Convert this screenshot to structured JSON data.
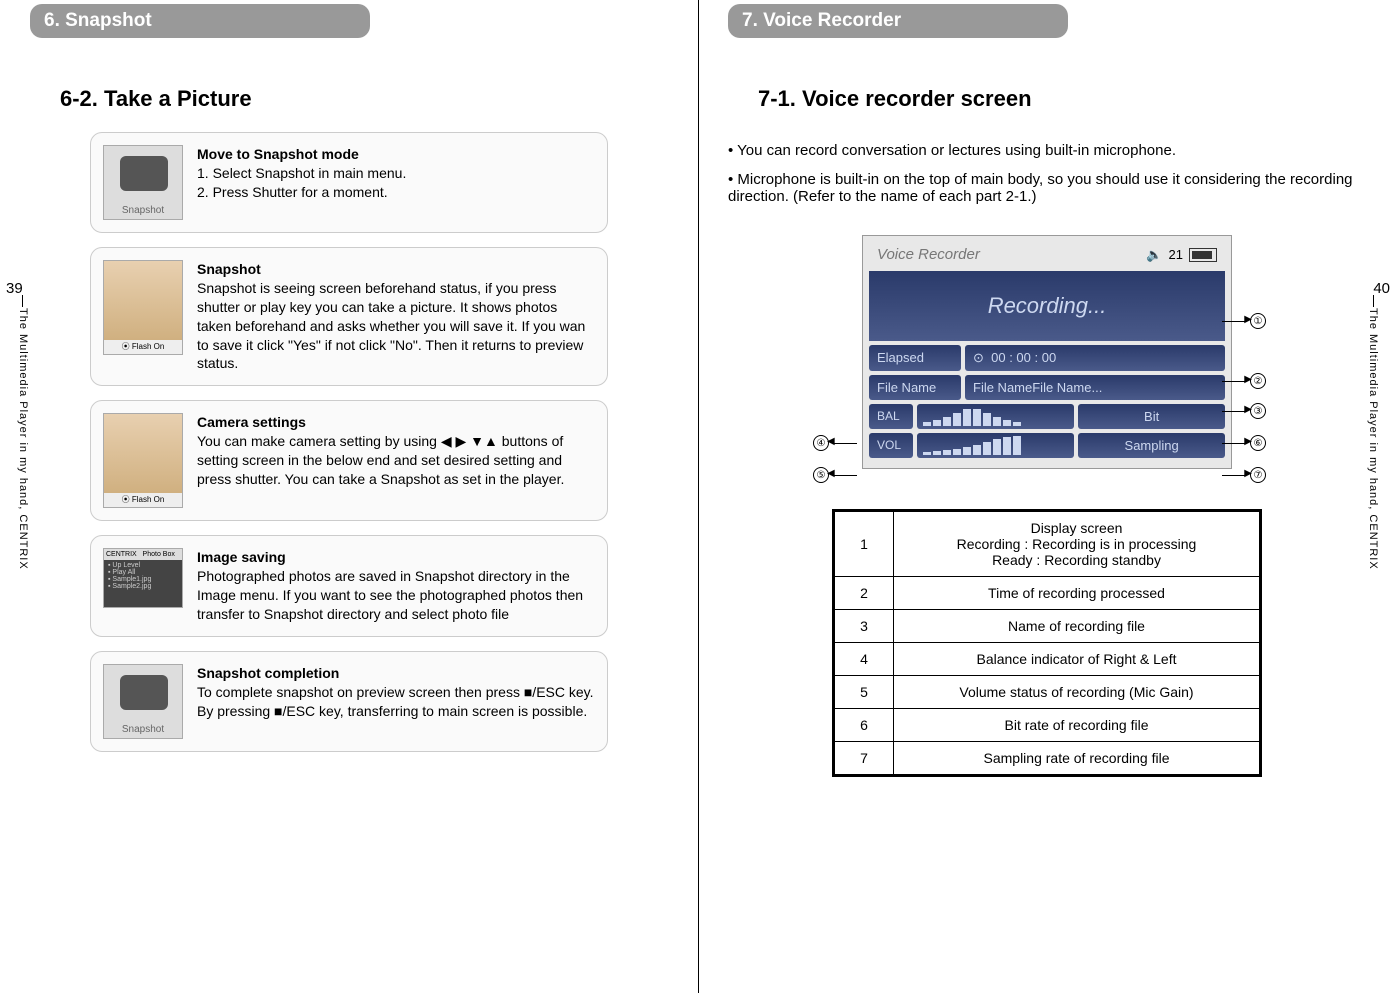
{
  "left": {
    "section_header": "6. Snapshot",
    "page_title": "6-2. Take a Picture",
    "page_number": "39",
    "sidebar": "The Multimedia Player in my hand, CENTRIX",
    "features": [
      {
        "title": "Move to Snapshot mode",
        "body": "1. Select Snapshot in main menu.\n2. Press Shutter for a moment."
      },
      {
        "title": "Snapshot",
        "body": "Snapshot is seeing screen beforehand status, if you press shutter or play key you can take a picture. It shows photos taken beforehand and asks whether you will save it. If  you wan to save it click \"Yes\" if not click \"No\". Then it returns to preview status."
      },
      {
        "title": "Camera settings",
        "body": "You can make camera setting  by using ◀ ▶ ▼▲ buttons of setting screen in the below end and set desired setting and press shutter. You can take a Snapshot as set in the player."
      },
      {
        "title": "Image saving",
        "body": "Photographed photos are saved in Snapshot directory in the Image menu. If you want to see the photographed photos then transfer to Snapshot directory and select photo file"
      },
      {
        "title": "Snapshot completion",
        "body": "To complete snapshot  on preview screen then press ■/ESC key.  By pressing ■/ESC key, transferring to main screen is possible."
      }
    ]
  },
  "right": {
    "section_header": "7. Voice Recorder",
    "page_title": "7-1. Voice recorder screen",
    "page_number": "40",
    "sidebar": "The Multimedia Player in my hand, CENTRIX",
    "intro1": "• You can record conversation or lectures using built-in microphone.",
    "intro2": "• Microphone is built-in on the top of main body, so you should use it considering the recording direction. (Refer to the name of each part 2-1.)",
    "vr": {
      "title": "Voice Recorder",
      "battery_num": "21",
      "status": "Recording...",
      "elapsed_label": "Elapsed",
      "elapsed_value": "00 : 00 : 00",
      "filename_label": "File Name",
      "filename_value": "File NameFile Name...",
      "bal": "BAL",
      "vol": "VOL",
      "bit": "Bit",
      "sampling": "Sampling"
    },
    "callouts": {
      "c1": "①",
      "c2": "②",
      "c3": "③",
      "c4": "④",
      "c5": "⑤",
      "c6": "⑥",
      "c7": "⑦"
    },
    "table": [
      {
        "n": "1",
        "d": "Display screen\nRecording : Recording is in processing\nReady : Recording standby"
      },
      {
        "n": "2",
        "d": "Time of recording processed"
      },
      {
        "n": "3",
        "d": "Name of recording file"
      },
      {
        "n": "4",
        "d": "Balance indicator of Right & Left"
      },
      {
        "n": "5",
        "d": "Volume status of recording (Mic Gain)"
      },
      {
        "n": "6",
        "d": "Bit rate of recording file"
      },
      {
        "n": "7",
        "d": "Sampling rate of recording file"
      }
    ]
  }
}
